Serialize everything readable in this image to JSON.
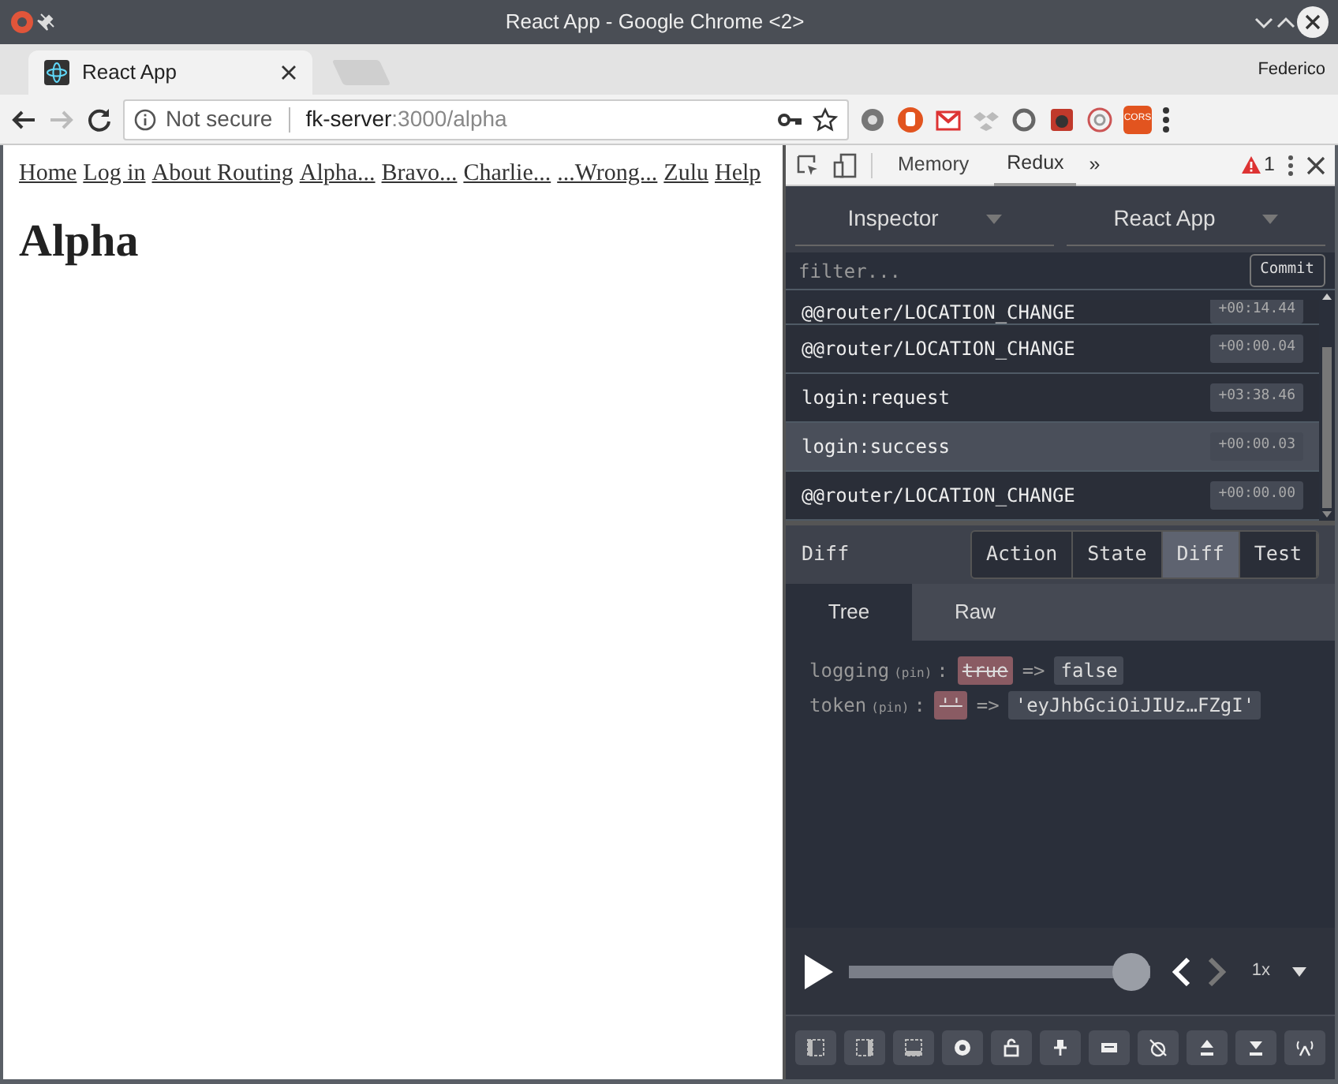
{
  "window": {
    "title": "React App - Google Chrome <2>"
  },
  "tabs": [
    {
      "label": "React App",
      "selected": true
    }
  ],
  "profile": "Federico",
  "address": {
    "security": "Not secure",
    "host": "fk-server",
    "path": ":3000/alpha"
  },
  "cors_badge": "CORS",
  "page": {
    "nav_links": [
      "Home",
      "Log in",
      "About Routing",
      "Alpha...",
      "Bravo...",
      "Charlie...",
      "...Wrong...",
      "Zulu",
      "Help"
    ],
    "heading": "Alpha"
  },
  "devtools": {
    "tabs": [
      {
        "label": "Memory",
        "selected": false
      },
      {
        "label": "Redux",
        "selected": true
      }
    ],
    "more": "»",
    "warning_count": "1",
    "monitor": "Inspector",
    "instance": "React App",
    "filter": {
      "placeholder": "filter..."
    },
    "commit": "Commit",
    "actions": [
      {
        "name": "@@router/LOCATION_CHANGE",
        "time": "+00:14.44",
        "selected": false
      },
      {
        "name": "@@router/LOCATION_CHANGE",
        "time": "+00:00.04",
        "selected": false
      },
      {
        "name": "login:request",
        "time": "+03:38.46",
        "selected": false
      },
      {
        "name": "login:success",
        "time": "+00:00.03",
        "selected": true
      },
      {
        "name": "@@router/LOCATION_CHANGE",
        "time": "+00:00.00",
        "selected": false
      }
    ],
    "detail_title": "Diff",
    "view_tabs": [
      {
        "label": "Action",
        "selected": false
      },
      {
        "label": "State",
        "selected": false
      },
      {
        "label": "Diff",
        "selected": true
      },
      {
        "label": "Test",
        "selected": false
      }
    ],
    "sub_tabs": [
      {
        "label": "Tree",
        "selected": true
      },
      {
        "label": "Raw",
        "selected": false
      }
    ],
    "diff": [
      {
        "key": "logging",
        "tag": "(pin)",
        "separator": ":",
        "old": "true",
        "arrow": "=>",
        "new": "false"
      },
      {
        "key": "token",
        "tag": "(pin)",
        "separator": ":",
        "old": "''",
        "arrow": "=>",
        "new": "'eyJhbGciOiJIUz…FZgI'"
      }
    ],
    "slider": {
      "level": 1
    },
    "speed": "1x"
  }
}
